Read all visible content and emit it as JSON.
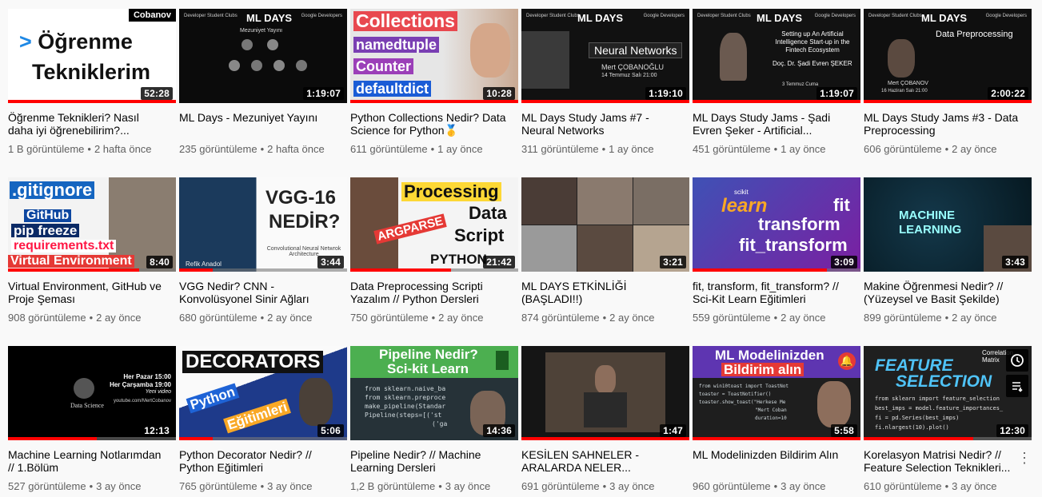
{
  "videos": [
    {
      "title": "Öğrenme Teknikleri? Nasıl daha iyi öğrenebilirim?...",
      "views": "1 B görüntüleme",
      "age": "2 hafta önce",
      "duration": "52:28",
      "progress": 1.0,
      "thumb_text": [
        "Cobanov",
        "> Öğrenme",
        "Tekniklerim"
      ]
    },
    {
      "title": "ML Days - Mezuniyet Yayını",
      "views": "235 görüntüleme",
      "age": "2 hafta önce",
      "duration": "1:19:07",
      "progress": 0,
      "thumb_text": [
        "Developer Student Clubs",
        "ML DAYS",
        "Google Developers",
        "Mezuniyet Yayını"
      ]
    },
    {
      "title": "Python Collections Nedir? Data Science for Python🥇",
      "views": "611 görüntüleme",
      "age": "1 ay önce",
      "duration": "10:28",
      "progress": 1.0,
      "thumb_text": [
        "Collections",
        "namedtuple",
        "Counter",
        "defaultdict"
      ]
    },
    {
      "title": "ML Days Study Jams #7 - Neural Networks",
      "views": "311 görüntüleme",
      "age": "1 ay önce",
      "duration": "1:19:10",
      "progress": 1.0,
      "thumb_text": [
        "Developer Student Clubs",
        "ML DAYS",
        "Google Developers",
        "Neural Networks",
        "Mert ÇOBANOĞLU",
        "14 Temmuz Salı 21:00"
      ]
    },
    {
      "title": "ML Days Study Jams - Şadi Evren Şeker - Artificial...",
      "views": "451 görüntüleme",
      "age": "1 ay önce",
      "duration": "1:19:07",
      "progress": 1.0,
      "thumb_text": [
        "Developer Student Clubs",
        "ML DAYS",
        "Google Developers",
        "Setting up An Artificial Intelligence Start-up in the Fintech Ecosystem",
        "Doç. Dr. Şadi Evren ŞEKER",
        "3 Temmuz Cuma"
      ]
    },
    {
      "title": "ML Days Study Jams #3 - Data Preprocessing",
      "views": "606 görüntüleme",
      "age": "2 ay önce",
      "duration": "2:00:22",
      "progress": 1.0,
      "thumb_text": [
        "Developer Student Clubs",
        "ML DAYS",
        "Google Developers",
        "Data Preprocessing",
        "Mert ÇOBANOV",
        "16 Haziran Salı 21:00"
      ]
    },
    {
      "title": "Virtual Environment, GitHub ve Proje Şeması",
      "views": "908 görüntüleme",
      "age": "2 ay önce",
      "duration": "8:40",
      "progress": 0.78,
      "thumb_text": [
        ".gitignore",
        "GitHub",
        "pip freeze",
        "requirements.txt",
        "Virtual Environment"
      ]
    },
    {
      "title": "VGG Nedir? CNN - Konvolüsyonel Sinir Ağları",
      "views": "680 görüntüleme",
      "age": "2 ay önce",
      "duration": "3:44",
      "progress": 0.2,
      "thumb_text": [
        "VGG-16",
        "NEDİR?",
        "Convolutional Neural Netwrok Architecture",
        "Refik Anadol"
      ]
    },
    {
      "title": "Data Preprocessing Scripti Yazalım // Python Dersleri",
      "views": "750 görüntüleme",
      "age": "2 ay önce",
      "duration": "21:42",
      "progress": 0.6,
      "thumb_text": [
        "Processing",
        "Data",
        "Script",
        "ARGPARSE",
        "PYTHON"
      ]
    },
    {
      "title": "ML DAYS ETKİNLİĞİ (BAŞLADI!!)",
      "views": "874 görüntüleme",
      "age": "2 ay önce",
      "duration": "3:21",
      "progress": 0,
      "thumb_text": []
    },
    {
      "title": "fit, transform, fit_transform? // Sci-Kit Learn Eğitimleri",
      "views": "559 görüntüleme",
      "age": "2 ay önce",
      "duration": "3:09",
      "progress": 0.8,
      "thumb_text": [
        "scikit",
        "learn",
        "fit",
        "transform",
        "fit_transform"
      ]
    },
    {
      "title": "Makine Öğrenmesi Nedir? // (Yüzeysel ve Basit Şekilde)",
      "views": "899 görüntüleme",
      "age": "2 ay önce",
      "duration": "3:43",
      "progress": 0,
      "thumb_text": [
        "MACHINE",
        "LEARNING"
      ]
    },
    {
      "title": "Machine Learning Notlarımdan // 1.Bölüm",
      "views": "527 görüntüleme",
      "age": "3 ay önce",
      "duration": "12:13",
      "progress": 0.53,
      "thumb_text": [
        "Her Pazar 15:00",
        "Her Çarşamba 19:00",
        "Yeni video",
        "Data Science",
        "youtube.com/MertCobanov"
      ]
    },
    {
      "title": "Python Decorator Nedir? // Python Eğitimleri",
      "views": "765 görüntüleme",
      "age": "3 ay önce",
      "duration": "5:06",
      "progress": 0.2,
      "thumb_text": [
        "DECORATORS",
        "Python",
        "Eğitimleri"
      ]
    },
    {
      "title": "Pipeline Nedir? // Machine Learning Dersleri",
      "views": "1,2 B görüntüleme",
      "age": "3 ay önce",
      "duration": "14:36",
      "progress": 0,
      "thumb_text": [
        "Pipeline Nedir?",
        "Sci-kit Learn",
        "from sklearn.naive_ba",
        "from sklearn.preproce",
        "make_pipeline(Standar",
        "Pipeline(steps=[('st",
        "('ga"
      ]
    },
    {
      "title": "KESİLEN SAHNELER - ARALARDA NELER...",
      "views": "691 görüntüleme",
      "age": "3 ay önce",
      "duration": "1:47",
      "progress": 1.0,
      "thumb_text": []
    },
    {
      "title": "ML Modelinizden Bildirim Alın",
      "views": "960 görüntüleme",
      "age": "3 ay önce",
      "duration": "5:58",
      "progress": 1.0,
      "thumb_text": [
        "ML Modelinizden",
        "Bildirim alın",
        "from win10toast import ToastNot",
        "toaster = ToastNotifier()",
        "toaster.show_toast(\"Herkese Me",
        "\"Mert Coban",
        "duration=10"
      ]
    },
    {
      "title": "Korelasyon Matrisi Nedir? // Feature Selection Teknikleri...",
      "views": "610 görüntüleme",
      "age": "3 ay önce",
      "duration": "12:30",
      "progress": 0.65,
      "thumb_text": [
        "FEATURE",
        "SELECTION",
        "Correlation Matrix",
        "from sklearn import feature_selection",
        "best_imps = model.feature_importances_",
        "fi = pd.Series(best_imps)",
        "fi.nlargest(10).plot()"
      ]
    }
  ],
  "hover_icons": [
    "clock-icon",
    "queue-icon"
  ],
  "menu_icon": "more-vert-icon"
}
